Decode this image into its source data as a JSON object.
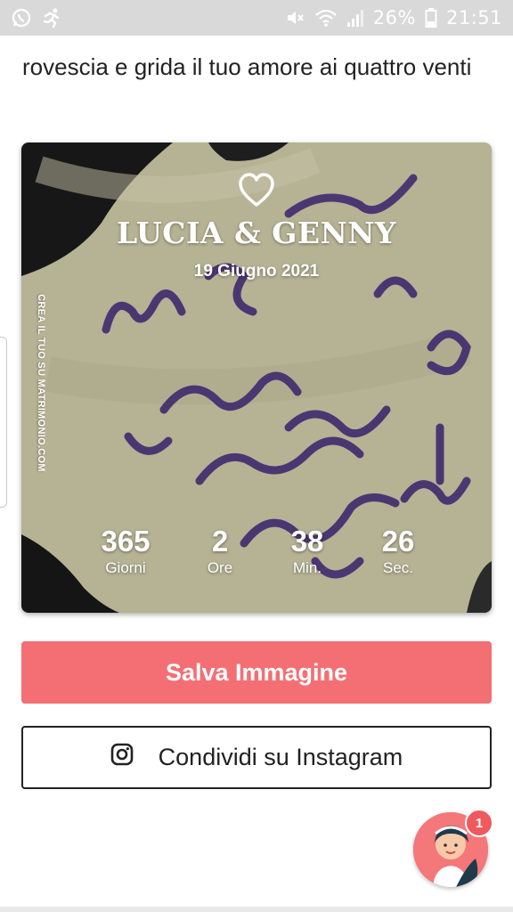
{
  "statusbar": {
    "battery": "26%",
    "time": "21:51",
    "icons": [
      "whatsapp-icon",
      "running-icon",
      "mute-icon",
      "wifi-icon",
      "signal-icon",
      "battery-icon"
    ]
  },
  "intro_text": "rovescia e grida il tuo amore ai quattro venti",
  "card": {
    "names": "LUCIA & GENNY",
    "date": "19 Giugno 2021",
    "side_text": "CREA IL TUO SU MATRIMONIO.COM",
    "countdown": [
      {
        "value": "365",
        "label": "Giorni"
      },
      {
        "value": "2",
        "label": "Ore"
      },
      {
        "value": "38",
        "label": "Min."
      },
      {
        "value": "26",
        "label": "Sec."
      }
    ]
  },
  "buttons": {
    "save": "Salva Immagine",
    "instagram": "Condividi su Instagram"
  },
  "assistant": {
    "badge_count": "1"
  },
  "colors": {
    "accent": "#f46f73",
    "statusbar": "#d9d9d9"
  }
}
